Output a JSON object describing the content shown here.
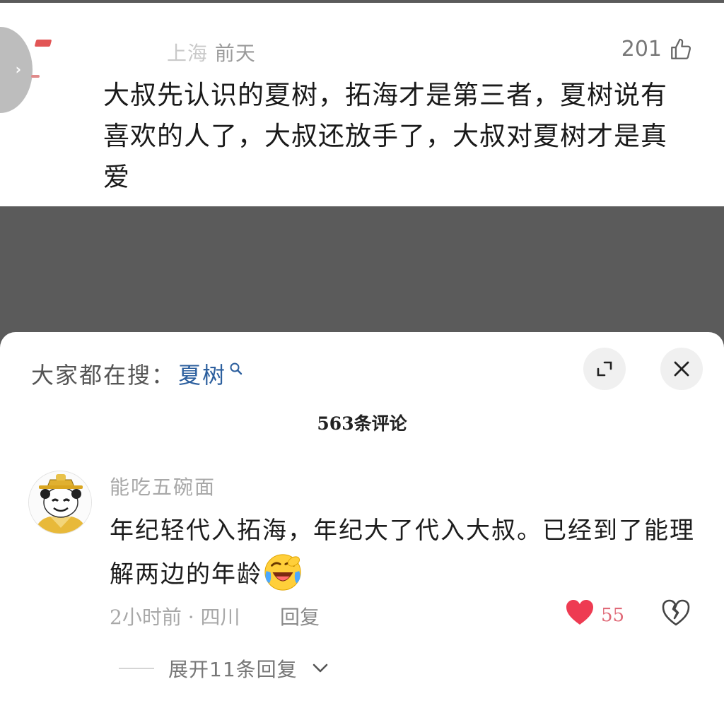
{
  "quoted_comment": {
    "location": "上海",
    "time": "前天",
    "like_count": "201",
    "text": "大叔先认识的夏树，拓海才是第三者，夏树说有喜欢的人了，大叔还放手了，大叔对夏树才是真爱"
  },
  "sheet": {
    "search_prefix": "大家都在搜：",
    "search_keyword": "夏树",
    "comment_count_label": "563条评论",
    "comment": {
      "username": "能吃五碗面",
      "text": "年纪轻代入拓海，年纪大了代入大叔。已经到了能理解两边的年龄",
      "emoji": "laughing-crying-emoji",
      "meta": "2小时前 · 四川",
      "reply_label": "回复",
      "like_count": "55",
      "liked": true
    },
    "expand_label": "展开11条回复"
  },
  "colors": {
    "overlay": "#5b5b5b",
    "keyword": "#2c5f9e",
    "like_red": "#ee3b52"
  }
}
